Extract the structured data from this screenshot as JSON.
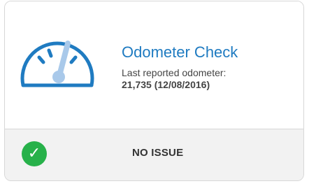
{
  "card": {
    "title": "Odometer Check",
    "subtitle": "Last reported odometer:",
    "reading": "21,735 (12/08/2016)",
    "icon": "speedometer-icon",
    "accent_color": "#1f7bc1"
  },
  "status": {
    "label": "NO ISSUE",
    "icon": "check-circle-icon",
    "icon_glyph": "✓",
    "color": "#27b14a"
  }
}
